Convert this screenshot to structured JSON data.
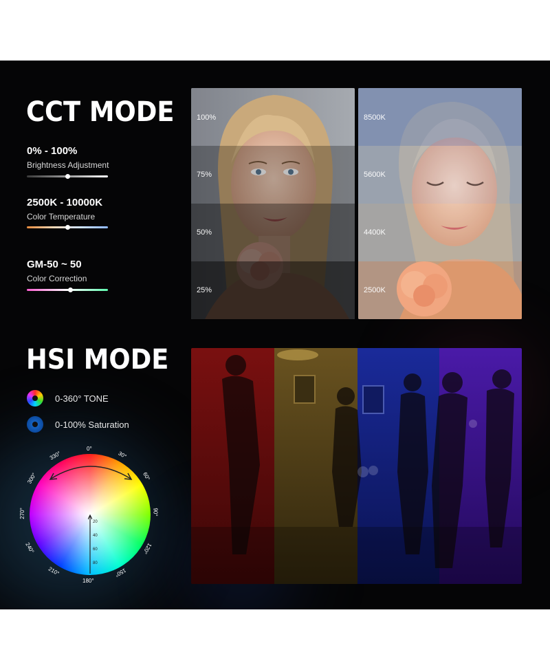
{
  "cct": {
    "title": "CCT MODE",
    "specs": [
      {
        "value": "0% - 100%",
        "label": "Brightness Adjustment",
        "level": 0.5
      },
      {
        "value": "2500K - 10000K",
        "label": "Color Temperature",
        "level": 0.5
      },
      {
        "value": "GM-50 ~ 50",
        "label": "Color Correction",
        "level": 0.5
      }
    ],
    "brightness_bands": [
      "100%",
      "75%",
      "50%",
      "25%"
    ],
    "temperature_bands": [
      "8500K",
      "5600K",
      "4400K",
      "2500K"
    ]
  },
  "hsi": {
    "title": "HSI MODE",
    "features": [
      {
        "icon": "color-wheel-icon",
        "label": "0-360° TONE"
      },
      {
        "icon": "saturation-icon",
        "label": "0-100% Saturation"
      }
    ],
    "hue_labels": [
      "0°",
      "30°",
      "60°",
      "90°",
      "120°",
      "150°",
      "180°",
      "210°",
      "240°",
      "270°",
      "300°",
      "330°"
    ],
    "saturation_scale": [
      "20",
      "40",
      "60",
      "80"
    ]
  }
}
